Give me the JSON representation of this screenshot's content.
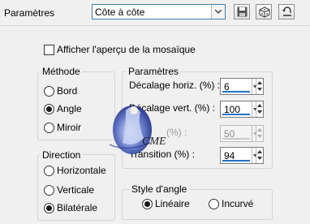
{
  "header": {
    "presets_label": "Paramètres",
    "presets_value": "Côte à côte"
  },
  "preview_checkbox": {
    "label": "Afficher l'aperçu de la mosaïque",
    "checked": false
  },
  "method": {
    "title": "Méthode",
    "options": [
      {
        "label": "Bord",
        "selected": false
      },
      {
        "label": "Angle",
        "selected": true
      },
      {
        "label": "Miroir",
        "selected": false
      }
    ]
  },
  "parameters": {
    "title": "Paramètres",
    "fields": [
      {
        "label": "Décalage horiz. (%) :",
        "value": "6",
        "enabled": true
      },
      {
        "label": "Décalage vert. (%) :",
        "value": "100",
        "enabled": true
      },
      {
        "label": "(%) :",
        "value": "50",
        "enabled": false
      },
      {
        "label": "Transition (%) :",
        "value": "94",
        "enabled": true
      }
    ]
  },
  "direction": {
    "title": "Direction",
    "options": [
      {
        "label": "Horizontale",
        "selected": false
      },
      {
        "label": "Verticale",
        "selected": false
      },
      {
        "label": "Bilatérale",
        "selected": true
      }
    ]
  },
  "corner_style": {
    "title": "Style d'angle",
    "options": [
      {
        "label": "Linéaire",
        "selected": true
      },
      {
        "label": "Incurvé",
        "selected": false
      }
    ]
  },
  "watermark": {
    "text": "CME"
  },
  "colors": {
    "accent": "#1f74c9",
    "combo_border": "#3c7fb1"
  }
}
